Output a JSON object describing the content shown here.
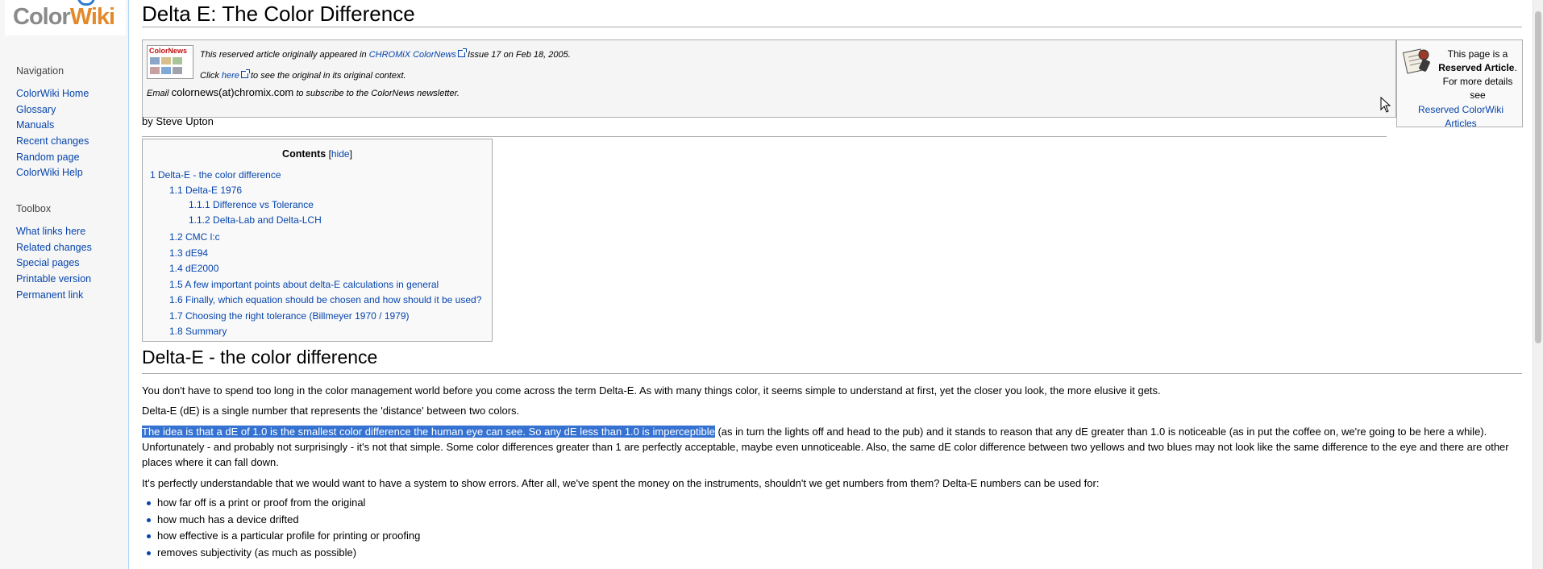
{
  "logo": {
    "part1": "Color",
    "part2": "Wiki"
  },
  "navigation": {
    "title": "Navigation",
    "items": [
      "ColorWiki Home",
      "Glossary",
      "Manuals",
      "Recent changes",
      "Random page",
      "ColorWiki Help"
    ]
  },
  "toolbox": {
    "title": "Toolbox",
    "items": [
      "What links here",
      "Related changes",
      "Special pages",
      "Printable version",
      "Permanent link"
    ]
  },
  "page": {
    "title": "Delta E: The Color Difference"
  },
  "notice": {
    "thumb_label": "ColorNews",
    "line1_pre": "This reserved article originally appeared in ",
    "line1_link": "CHROMiX ColorNews",
    "line1_post": " Issue 17 on Feb 18, 2005.",
    "line2_pre": "Click ",
    "line2_link": "here",
    "line2_post": " to see the original in its original context.",
    "line3_pre": "Email ",
    "line3_email": "colornews(at)chromix.com",
    "line3_post": " to subscribe to the ColorNews newsletter."
  },
  "reserved": {
    "text1": "This page is a ",
    "bold": "Reserved Article",
    "text2": ". For more details see",
    "link": "Reserved ColorWiki Articles"
  },
  "author": "by Steve Upton",
  "toc": {
    "title": "Contents",
    "hide_open": "[",
    "hide": "hide",
    "hide_close": "]",
    "items": [
      "1 Delta-E - the color difference",
      "1.1 Delta-E 1976",
      "1.1.1 Difference vs Tolerance",
      "1.1.2 Delta-Lab and Delta-LCH",
      "1.2 CMC l:c",
      "1.3 dE94",
      "1.4 dE2000",
      "1.5 A few important points about delta-E calculations in general",
      "1.6 Finally, which equation should be chosen and how should it be used?",
      "1.7 Choosing the right tolerance (Billmeyer 1970 / 1979)",
      "1.8 Summary"
    ]
  },
  "section": {
    "heading": "Delta-E - the color difference",
    "p1": "You don't have to spend too long in the color management world before you come across the term Delta-E. As with many things color, it seems simple to understand at first, yet the closer you look, the more elusive it gets.",
    "p2": "Delta-E (dE) is a single number that represents the 'distance' between two colors.",
    "p3_highlight": "The idea is that a dE of 1.0 is the smallest color difference the human eye can see. So any dE less than 1.0 is imperceptible",
    "p3_rest": " (as in turn the lights off and head to the pub) and it stands to reason that any dE greater than 1.0 is noticeable (as in put the coffee on, we're going to be here a while). Unfortunately - and probably not surprisingly - it's not that simple. Some color differences greater than 1 are perfectly acceptable, maybe even unnoticeable. Also, the same dE color difference between two yellows and two blues may not look like the same difference to the eye and there are other places where it can fall down.",
    "p4": "It's perfectly understandable that we would want to have a system to show errors. After all, we've spent the money on the instruments, shouldn't we get numbers from them? Delta-E numbers can be used for:",
    "bullets": [
      "how far off is a print or proof from the original",
      "how much has a device drifted",
      "how effective is a particular profile for printing or proofing",
      "removes subjectivity (as much as possible)"
    ]
  }
}
